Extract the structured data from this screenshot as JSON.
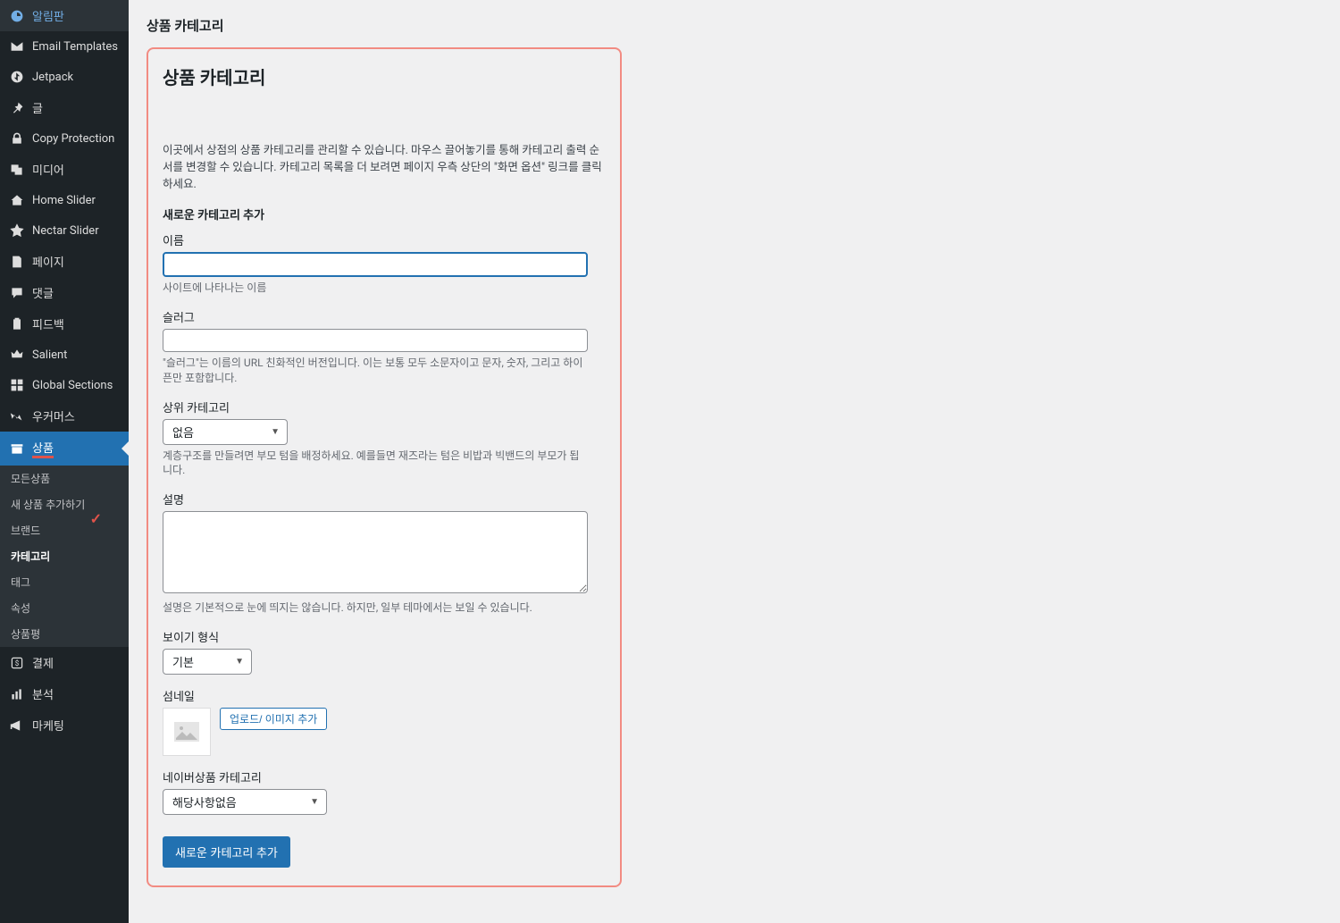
{
  "sidebar": {
    "items": [
      {
        "label": "알림판"
      },
      {
        "label": "Email Templates"
      },
      {
        "label": "Jetpack"
      },
      {
        "label": "글"
      },
      {
        "label": "Copy Protection"
      },
      {
        "label": "미디어"
      },
      {
        "label": "Home Slider"
      },
      {
        "label": "Nectar Slider"
      },
      {
        "label": "페이지"
      },
      {
        "label": "댓글"
      },
      {
        "label": "피드백"
      },
      {
        "label": "Salient"
      },
      {
        "label": "Global Sections"
      },
      {
        "label": "우커머스"
      },
      {
        "label": "상품"
      },
      {
        "label": "결제"
      },
      {
        "label": "분석"
      },
      {
        "label": "마케팅"
      }
    ],
    "sub_products": [
      {
        "label": "모든상품"
      },
      {
        "label": "새 상품 추가하기"
      },
      {
        "label": "브랜드"
      },
      {
        "label": "카테고리"
      },
      {
        "label": "태그"
      },
      {
        "label": "속성"
      },
      {
        "label": "상품평"
      }
    ]
  },
  "header": {
    "title": "상품 카테고리"
  },
  "panel": {
    "heading": "상품 카테고리",
    "intro": "이곳에서 상점의 상품 카테고리를 관리할 수 있습니다. 마우스 끌어놓기를 통해 카테고리 출력 순서를 변경할 수 있습니다. 카테고리 목록을 더 보려면 페이지 우측 상단의 \"화면 옵션\" 링크를 클릭하세요.",
    "section_title": "새로운 카테고리 추가",
    "fields": {
      "name": {
        "label": "이름",
        "help": "사이트에 나타나는 이름"
      },
      "slug": {
        "label": "슬러그",
        "help": "\"슬러그\"는 이름의 URL 친화적인 버전입니다. 이는 보통 모두 소문자이고 문자, 숫자, 그리고 하이픈만 포함합니다."
      },
      "parent": {
        "label": "상위 카테고리",
        "selected": "없음",
        "help": "계층구조를 만들려면 부모 텀을 배정하세요. 예를들면 재즈라는 텀은 비밥과 빅밴드의 부모가 됩니다."
      },
      "description": {
        "label": "설명",
        "help": "설명은 기본적으로 눈에 띄지는 않습니다. 하지만, 일부 테마에서는 보일 수 있습니다."
      },
      "display": {
        "label": "보이기 형식",
        "selected": "기본"
      },
      "thumbnail": {
        "label": "섬네일",
        "button": "업로드/ 이미지 추가"
      },
      "naver": {
        "label": "네이버상품 카테고리",
        "selected": "해당사항없음"
      }
    },
    "submit": "새로운 카테고리 추가"
  }
}
